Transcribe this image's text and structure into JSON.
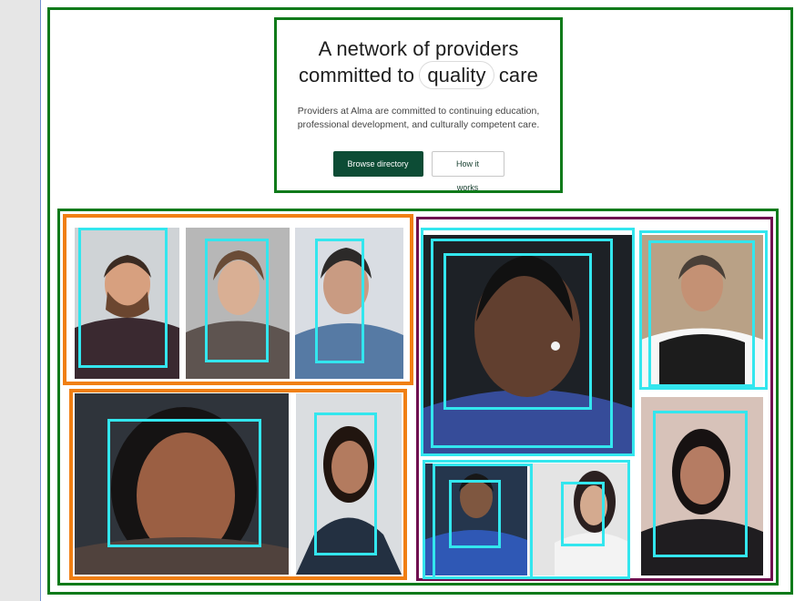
{
  "hero": {
    "headline_line1": "A network of  providers",
    "headline_prefix": "committed to",
    "headline_accent": "quality",
    "headline_suffix": " care",
    "subtitle": "Providers at Alma are committed to continuing education, professional development, and culturally competent care.",
    "primary_button": "Browse directory",
    "secondary_button": "How it works"
  },
  "colors": {
    "brand": "#0d4c35",
    "annotation_green": "#0f7a1a",
    "annotation_orange": "#f07f13",
    "annotation_purple": "#6f0f4f",
    "annotation_cyan": "#33e6ee"
  },
  "provider_photos": [
    "provider-photo-man-glasses-plaid",
    "provider-photo-woman-short-hair",
    "provider-photo-man-glasses-hand-on-chin",
    "provider-photo-woman-curly-hair-smiling",
    "provider-photo-woman-long-dark-hair",
    "provider-photo-woman-hair-pulled-back",
    "provider-photo-man-gray-beard",
    "provider-photo-man-blue-shirt",
    "provider-photo-woman-asian",
    "provider-photo-woman-dark-hair-black-top"
  ]
}
